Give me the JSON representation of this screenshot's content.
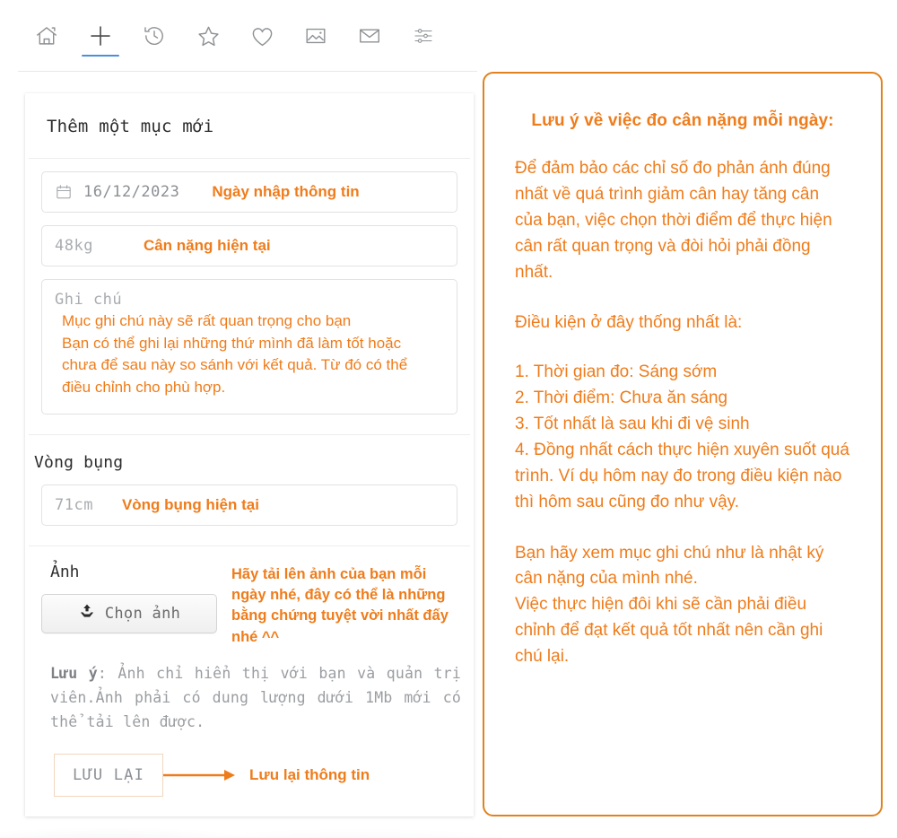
{
  "tabs": [
    {
      "icon": "home-icon",
      "name": "tab-home",
      "active": false
    },
    {
      "icon": "plus-icon",
      "name": "tab-add",
      "active": true
    },
    {
      "icon": "history-icon",
      "name": "tab-history",
      "active": false
    },
    {
      "icon": "star-icon",
      "name": "tab-favorite",
      "active": false
    },
    {
      "icon": "heart-icon",
      "name": "tab-likes",
      "active": false
    },
    {
      "icon": "image-icon",
      "name": "tab-photos",
      "active": false
    },
    {
      "icon": "mail-icon",
      "name": "tab-messages",
      "active": false
    },
    {
      "icon": "sliders-icon",
      "name": "tab-settings",
      "active": false
    }
  ],
  "accent_color": "#ef7c1b",
  "panel_border_color": "#e0821e",
  "tab_active_color": "#4a90d9",
  "form": {
    "title": "Thêm một mục mới",
    "date": {
      "value": "16/12/2023",
      "hint": "Ngày nhập thông tin"
    },
    "weight": {
      "placeholder": "48kg",
      "value": "",
      "hint": "Cân nặng hiện tại"
    },
    "notes": {
      "placeholder": "Ghi chú",
      "value": "",
      "hint_lines": [
        "Mục ghi chú này sẽ rất quan trọng cho bạn",
        "Bạn có thể ghi lại những thứ mình đã làm tốt hoặc",
        "chưa để sau này so sánh với kết quả. Từ đó có thể",
        "điều chỉnh cho phù hợp."
      ]
    },
    "waist": {
      "section_label": "Vòng bụng",
      "placeholder": "71cm",
      "value": "",
      "hint": "Vòng bụng hiện tại"
    },
    "photo": {
      "label": "Ảnh",
      "button_label": "Chọn ảnh",
      "hint": "Hãy tải lên ảnh của bạn mỗi ngày nhé, đây có thể là những bằng chứng tuyệt vời nhất đấy nhé ^^",
      "note_prefix": "Lưu ý",
      "note_body": ": Ảnh chỉ hiển thị với bạn và quản trị viên.Ảnh phải có dung lượng dưới 1Mb mới có thể tải lên được."
    },
    "save": {
      "button_label": "LƯU LẠI",
      "hint": "Lưu lại thông tin"
    }
  },
  "info_panel": {
    "title": "Lưu ý về việc đo cân nặng mỗi ngày:",
    "paragraph_1": "Để đảm bảo các chỉ số đo phản ánh đúng nhất về quá trình giảm cân hay tăng cân của bạn, việc chọn thời điểm để thực hiện cân rất quan trọng và đòi hỏi phải đồng nhất.",
    "paragraph_2": "Điều kiện ở đây thống nhất là:",
    "list_items": [
      "1. Thời gian đo: Sáng sớm",
      "2. Thời điểm: Chưa ăn sáng",
      "3. Tốt nhất là sau khi đi vệ sinh",
      "4. Đồng nhất cách thực hiện xuyên suốt quá trình. Ví dụ hôm nay đo trong điều kiện nào thì hôm sau cũng đo như vậy."
    ],
    "paragraph_3": "Bạn hãy xem mục ghi chú như là nhật ký cân nặng của mình nhé.",
    "paragraph_4": "Việc thực hiện đôi khi sẽ cần phải điều chỉnh để đạt kết quả tốt nhất nên cần ghi chú lại."
  }
}
